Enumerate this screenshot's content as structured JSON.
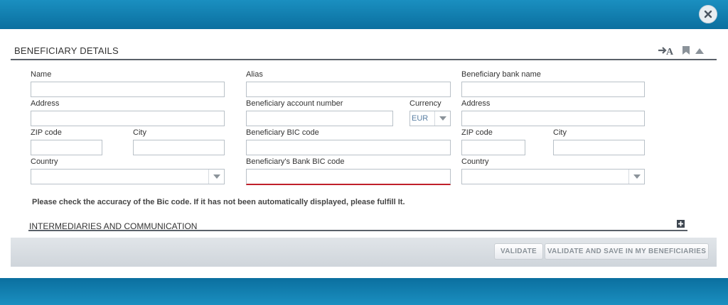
{
  "modal": {
    "close_icon": "close-icon"
  },
  "section": {
    "title": "BENEFICIARY DETAILS",
    "icons": [
      "translate-icon",
      "bookmark-icon",
      "collapse-up-icon"
    ]
  },
  "fields": {
    "name_label": "Name",
    "alias_label": "Alias",
    "bank_name_label": "Beneficiary bank name",
    "address_label": "Address",
    "account_number_label": "Beneficiary account number",
    "currency_label": "Currency",
    "currency_value": "EUR",
    "bank_address_label": "Address",
    "zip_label": "ZIP code",
    "city_label": "City",
    "bic_label": "Beneficiary BIC code",
    "bank_zip_label": "ZIP code",
    "bank_city_label": "City",
    "country_label": "Country",
    "bank_bic_label": "Beneficiary's Bank BIC code",
    "bank_country_label": "Country"
  },
  "notice": "Please check the accuracy of the Bic code. If it has not been automatically displayed, please fulfill It.",
  "subsection": {
    "title": "INTERMEDIARIES AND COMMUNICATION",
    "icon": "expand-plus-icon"
  },
  "footer": {
    "validate_label": "VALIDATE",
    "validate_save_label": "VALIDATE AND SAVE IN MY BENEFICIARIES"
  },
  "colors": {
    "header_blue": "#0b6f9f",
    "error_red": "#c0202a",
    "divider": "#5a6169"
  }
}
